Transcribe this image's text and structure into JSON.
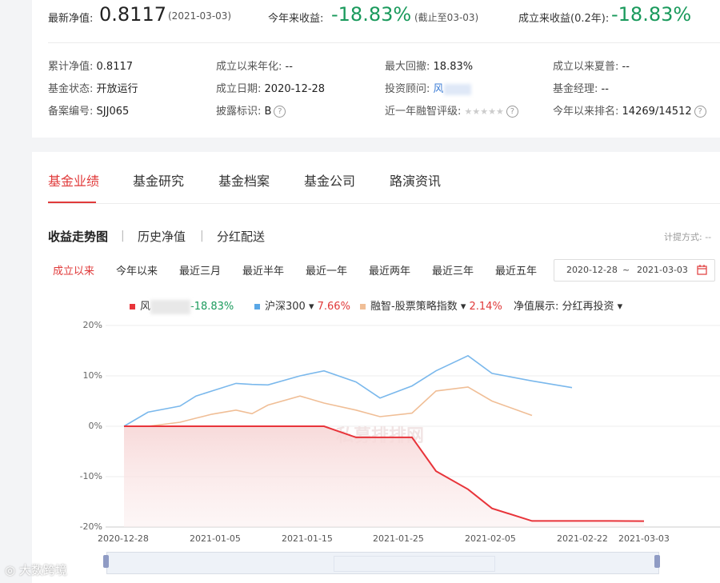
{
  "summary": {
    "nav_label": "最新净值:",
    "nav_value": "0.8117",
    "nav_date": "(2021-03-03)",
    "ytd_label": "今年来收益:",
    "ytd_value": "-18.83%",
    "ytd_note": "(截止至03-03)",
    "since_label": "成立来收益(0.2年):",
    "since_value": "-18.83%"
  },
  "info": {
    "cum_nav_label": "累计净值:",
    "cum_nav": "0.8117",
    "annual_label": "成立以来年化:",
    "annual": "--",
    "drawdown_label": "最大回撤:",
    "drawdown": "18.83%",
    "sharpe_label": "成立以来夏普:",
    "sharpe": "--",
    "status_label": "基金状态:",
    "status": "开放运行",
    "inception_label": "成立日期:",
    "inception": "2020-12-28",
    "advisor_label": "投资顾问:",
    "advisor": "风",
    "manager_label": "基金经理:",
    "manager": "--",
    "record_label": "备案编号:",
    "record": "SJJ065",
    "disclosure_label": "披露标识:",
    "disclosure": "B",
    "rating_label": "近一年融智评级:",
    "rating_stars": "★★★★★",
    "rank_label": "今年以来排名:",
    "rank": "14269/14512",
    "help_icon": "?"
  },
  "tabs": [
    "基金业绩",
    "基金研究",
    "基金档案",
    "基金公司",
    "路演资讯"
  ],
  "subtabs": {
    "items": [
      "收益走势图",
      "历史净值",
      "分红配送"
    ],
    "separator": "|"
  },
  "calc_label": "计提方式: --",
  "ranges": [
    "成立以来",
    "今年以来",
    "最近三月",
    "最近半年",
    "最近一年",
    "最近两年",
    "最近三年",
    "最近五年"
  ],
  "date_range": {
    "start": "2020-12-28",
    "sep": "~",
    "end": "2021-03-03"
  },
  "legend": {
    "fund_name": "风",
    "fund_return": "-18.83%",
    "index1_name": "沪深300 ▾",
    "index1_return": "7.66%",
    "index2_name": "融智-股票策略指数 ▾",
    "index2_return": "2.14%",
    "display_label": "净值展示:",
    "display_value": "分红再投资 ▾"
  },
  "colors": {
    "fund": "#e8343a",
    "index1": "#7ab8ec",
    "index2": "#f0be96",
    "accent": "#e03a3a",
    "gain": "#1a9a5c"
  },
  "chart_data": {
    "type": "line",
    "x": [
      "2020-12-28",
      "2020-12-31",
      "2021-01-04",
      "2021-01-06",
      "2021-01-08",
      "2021-01-11",
      "2021-01-13",
      "2021-01-15",
      "2021-01-19",
      "2021-01-22",
      "2021-01-26",
      "2021-01-29",
      "2021-02-02",
      "2021-02-05",
      "2021-02-09",
      "2021-02-12",
      "2021-02-17",
      "2021-02-22",
      "2021-02-26",
      "2021-03-03"
    ],
    "series": [
      {
        "name": "风",
        "values": [
          0,
          0,
          0,
          0,
          0,
          0,
          0,
          0,
          0,
          0,
          -2.2,
          -2.2,
          -2.2,
          -8.9,
          -12.5,
          -16.3,
          -18.8,
          -18.8,
          -18.8,
          -18.83
        ]
      },
      {
        "name": "沪深300",
        "values": [
          0,
          2.8,
          4.0,
          6.0,
          7.0,
          8.5,
          8.3,
          8.2,
          10.0,
          11.0,
          8.8,
          5.6,
          8.0,
          11.0,
          14.0,
          10.5,
          9.0,
          7.66,
          null,
          null
        ]
      },
      {
        "name": "融智-股票策略指数",
        "values": [
          0,
          0,
          0.8,
          1.6,
          2.4,
          3.2,
          2.5,
          4.2,
          6.0,
          4.6,
          3.2,
          1.9,
          2.6,
          7.0,
          7.8,
          5.0,
          2.14,
          null,
          null,
          null
        ]
      }
    ],
    "ylim": [
      -20,
      20
    ],
    "yticks": [
      "20%",
      "10%",
      "0%",
      "-10%",
      "-20%"
    ],
    "xticks": [
      "2020-12-28",
      "2021-01-05",
      "2021-01-15",
      "2021-01-25",
      "2021-02-05",
      "2021-02-22",
      "2021-03-03"
    ]
  },
  "watermark": "大数跨境"
}
